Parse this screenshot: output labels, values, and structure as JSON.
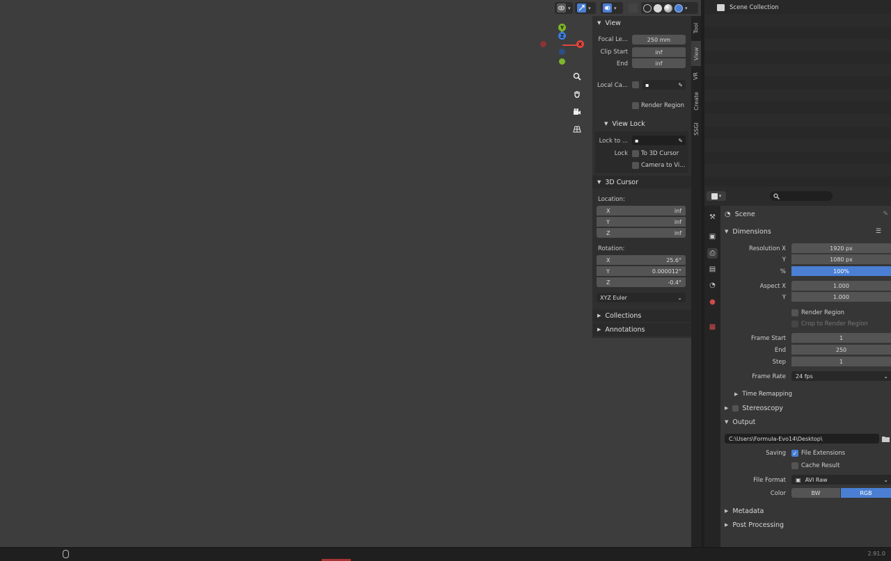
{
  "viewport": {
    "gizmo": {
      "x_label": "X",
      "y_label": "Y",
      "z_label": "Z"
    }
  },
  "npanel": {
    "tabs": [
      "Tool",
      "View",
      "VR",
      "Create",
      "SSGI"
    ],
    "active_tab": "View",
    "view": {
      "title": "View",
      "focal_label": "Focal Le...",
      "focal_value": "250 mm",
      "clip_start_label": "Clip Start",
      "clip_start_value": "inf",
      "end_label": "End",
      "end_value": "inf",
      "local_camera_label": "Local Ca...",
      "render_region_label": "Render Region"
    },
    "view_lock": {
      "title": "View Lock",
      "lock_to_label": "Lock to ...",
      "lock_label": "Lock",
      "to_3d_cursor_label": "To 3D Cursor",
      "camera_to_view_label": "Camera to Vi..."
    },
    "cursor": {
      "title": "3D Cursor",
      "location_label": "Location:",
      "loc_x_label": "X",
      "loc_x_value": "inf",
      "loc_y_label": "Y",
      "loc_y_value": "inf",
      "loc_z_label": "Z",
      "loc_z_value": "inf",
      "rotation_label": "Rotation:",
      "rot_x_label": "X",
      "rot_x_value": "25.6°",
      "rot_y_label": "Y",
      "rot_y_value": "0.000012°",
      "rot_z_label": "Z",
      "rot_z_value": "-0.4°",
      "rotation_mode": "XYZ Euler"
    },
    "collections_title": "Collections",
    "annotations_title": "Annotations"
  },
  "outliner": {
    "root_label": "Scene Collection"
  },
  "properties": {
    "context_label": "Scene",
    "dimensions": {
      "title": "Dimensions",
      "res_x_label": "Resolution X",
      "res_x_value": "1920 px",
      "res_y_label": "Y",
      "res_y_value": "1080 px",
      "pct_label": "%",
      "pct_value": "100%",
      "aspect_x_label": "Aspect X",
      "aspect_x_value": "1.000",
      "aspect_y_label": "Y",
      "aspect_y_value": "1.000",
      "render_region_label": "Render Region",
      "crop_label": "Crop to Render Region",
      "frame_start_label": "Frame Start",
      "frame_start_value": "1",
      "end_label": "End",
      "end_value": "250",
      "step_label": "Step",
      "step_value": "1",
      "frame_rate_label": "Frame Rate",
      "frame_rate_value": "24 fps",
      "time_remapping_title": "Time Remapping"
    },
    "stereoscopy_title": "Stereoscopy",
    "output": {
      "title": "Output",
      "path": "C:\\Users\\Formula-Evo14\\Desktop\\",
      "saving_label": "Saving",
      "file_extensions_label": "File Extensions",
      "cache_result_label": "Cache Result",
      "file_format_label": "File Format",
      "file_format_value": "AVI Raw",
      "color_label": "Color",
      "color_bw": "BW",
      "color_rgb": "RGB"
    },
    "metadata_title": "Metadata",
    "post_processing_title": "Post Processing"
  },
  "statusbar": {
    "version": "2.91.0"
  },
  "colors": {
    "accent": "#4a7fd4",
    "x_axis": "#e0463f",
    "y_axis": "#7db62a",
    "z_axis": "#3f7cd9"
  }
}
